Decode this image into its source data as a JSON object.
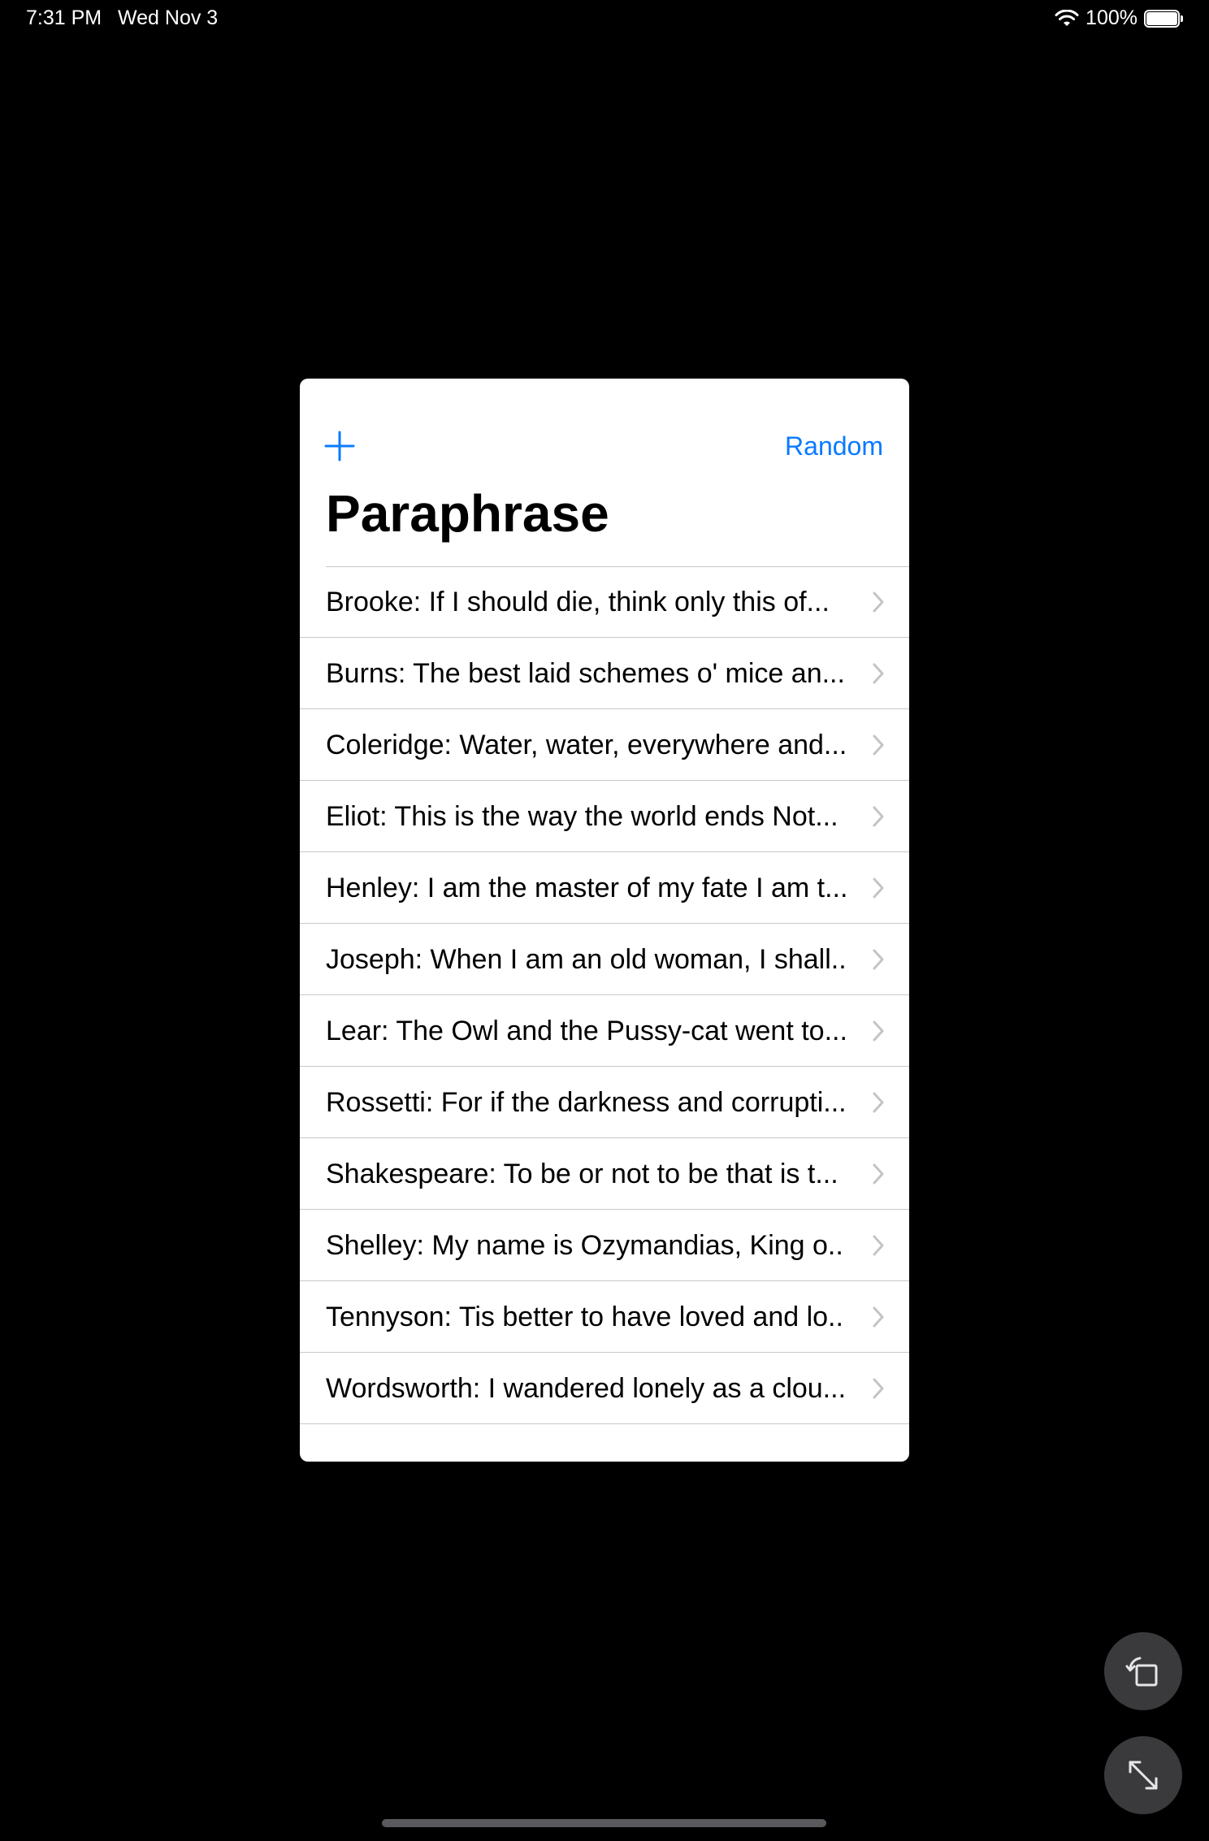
{
  "status_bar": {
    "time": "7:31 PM",
    "date": "Wed Nov 3",
    "battery": "100%"
  },
  "colors": {
    "accent": "#0a7aff",
    "background": "#000000",
    "card": "#ffffff"
  },
  "toolbar": {
    "add_icon": "plus-icon",
    "random_label": "Random"
  },
  "title": "Paraphrase",
  "list": {
    "items": [
      {
        "label": "Brooke: If I should die, think only this of..."
      },
      {
        "label": "Burns: The best laid schemes o' mice an..."
      },
      {
        "label": "Coleridge: Water, water, everywhere and..."
      },
      {
        "label": "Eliot: This is the way the world ends Not..."
      },
      {
        "label": "Henley: I am the master of my fate I am t..."
      },
      {
        "label": "Joseph: When I am an old woman, I shall..."
      },
      {
        "label": "Lear: The Owl and the Pussy-cat went to..."
      },
      {
        "label": "Rossetti: For if the darkness and corrupti..."
      },
      {
        "label": "Shakespeare: To be or not to be that is t..."
      },
      {
        "label": "Shelley: My name is Ozymandias, King o..."
      },
      {
        "label": "Tennyson: Tis better to have loved and lo..."
      },
      {
        "label": "Wordsworth: I wandered lonely as a clou..."
      }
    ]
  },
  "floating_buttons": {
    "rotate_icon": "rotate-icon",
    "fullscreen_icon": "expand-icon"
  }
}
